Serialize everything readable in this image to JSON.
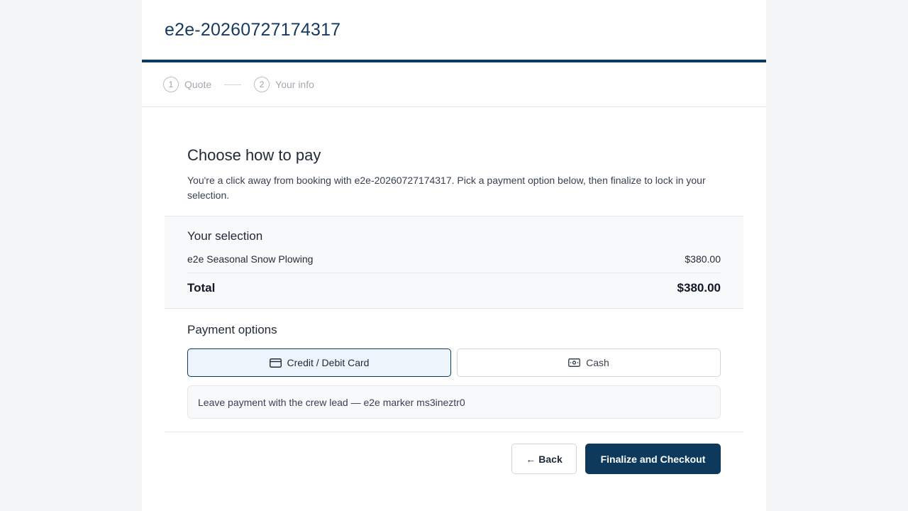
{
  "header": {
    "title": "e2e-20260727174317"
  },
  "steps": [
    {
      "num": "1",
      "label": "Quote"
    },
    {
      "num": "2",
      "label": "Your info"
    }
  ],
  "intro": {
    "heading": "Choose how to pay",
    "text": "You're a click away from booking with e2e-20260727174317. Pick a payment option below, then finalize to lock in your selection."
  },
  "selection": {
    "title": "Your selection",
    "item": {
      "name": "e2e Seasonal Snow Plowing",
      "price": "$380.00"
    },
    "total_label": "Total",
    "total_value": "$380.00"
  },
  "payment": {
    "title": "Payment options",
    "options": [
      {
        "label": "Credit / Debit Card",
        "icon": "credit-card-icon",
        "selected": true
      },
      {
        "label": "Cash",
        "icon": "cash-icon",
        "selected": false
      }
    ],
    "note": "Leave payment with the crew lead — e2e marker ms3ineztr0"
  },
  "actions": {
    "back_arrow": "←",
    "back_label": "Back",
    "checkout_label": "Finalize and Checkout"
  },
  "colors": {
    "brand": "#0d3a5c",
    "selected_bg": "#eef4fc",
    "page_bg": "#f3f5f7"
  }
}
